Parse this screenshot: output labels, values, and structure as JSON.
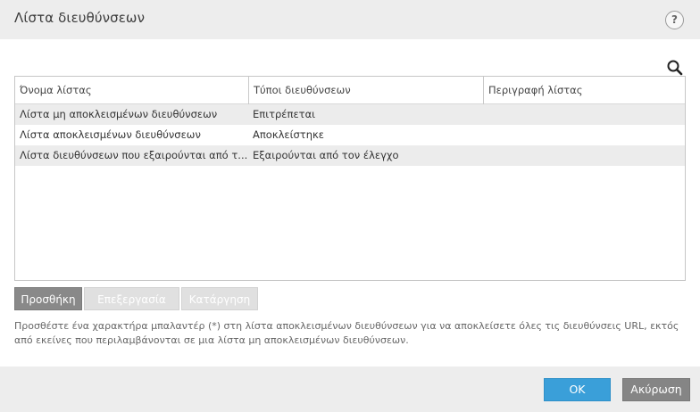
{
  "window": {
    "title": "Λίστα διευθύνσεων",
    "help_symbol": "?"
  },
  "table": {
    "columns": [
      "Όνομα λίστας",
      "Τύποι διευθύνσεων",
      "Περιγραφή λίστας"
    ],
    "rows": [
      {
        "name": "Λίστα μη αποκλεισμένων διευθύνσεων",
        "type": "Επιτρέπεται",
        "description": ""
      },
      {
        "name": "Λίστα αποκλεισμένων διευθύνσεων",
        "type": "Αποκλείστηκε",
        "description": ""
      },
      {
        "name": "Λίστα διευθύνσεων που εξαιρούνται από τ...",
        "type": "Εξαιρούνται από τον έλεγχο",
        "description": ""
      }
    ]
  },
  "actions": {
    "add_label": "Προσθήκη",
    "edit_label": "Επεξεργασία",
    "remove_label": "Κατάργηση"
  },
  "hint": "Προσθέστε ένα χαρακτήρα μπαλαντέρ (*) στη λίστα αποκλεισμένων διευθύνσεων για να αποκλείσετε όλες τις διευθύνσεις URL, εκτός από εκείνες που περιλαμβάνονται σε μια λίστα μη αποκλεισμένων διευθύνσεων.",
  "footer": {
    "ok_label": "OK",
    "cancel_label": "Ακύρωση"
  },
  "icons": {
    "search": "search-icon",
    "help": "help-icon"
  },
  "colors": {
    "ok_button": "#3a9fd9",
    "gray_button": "#898989",
    "disabled_button": "#e0e0e0",
    "header_bg": "#ededed",
    "alt_row": "#ececec"
  }
}
